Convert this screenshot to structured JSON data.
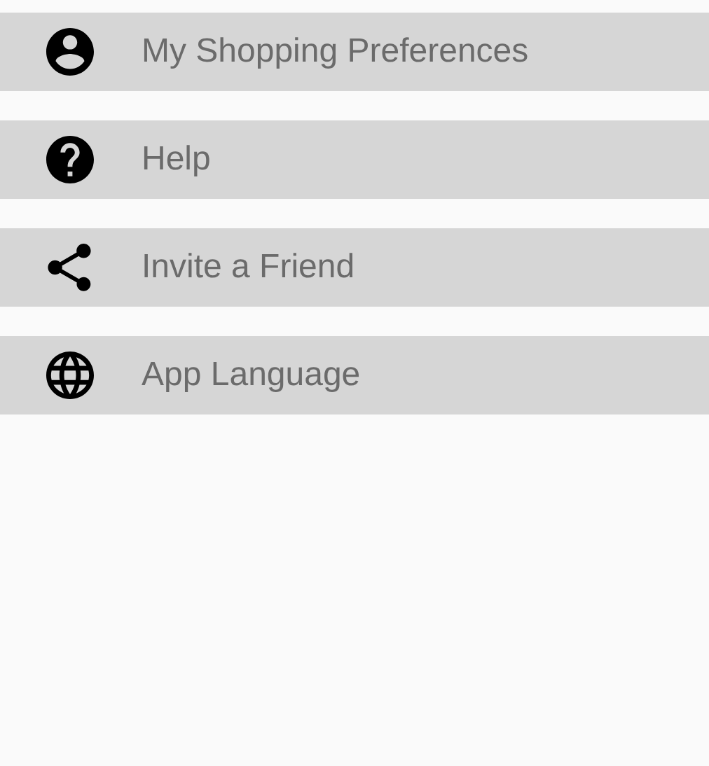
{
  "menu_items": [
    {
      "kind": "account",
      "label": "My Shopping Preferences"
    },
    {
      "kind": "help",
      "label": "Help"
    },
    {
      "kind": "share",
      "label": "Invite a Friend"
    },
    {
      "kind": "language",
      "label": "App Language"
    }
  ]
}
